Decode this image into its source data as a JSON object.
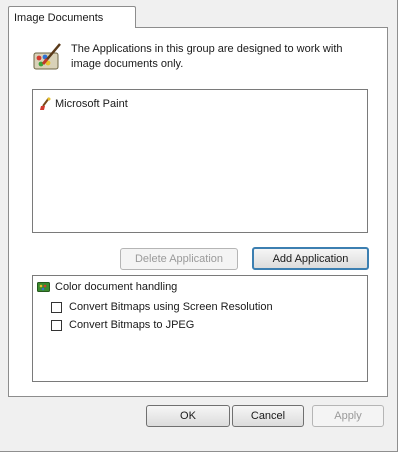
{
  "tab": {
    "label": "Image Documents"
  },
  "description": "The Applications in this group are designed to work with image documents only.",
  "applications": [
    {
      "label": "Microsoft Paint"
    }
  ],
  "buttons": {
    "delete": "Delete Application",
    "add": "Add Application",
    "ok": "OK",
    "cancel": "Cancel",
    "apply": "Apply"
  },
  "options": {
    "header": "Color document handling",
    "checkboxes": [
      {
        "label": "Convert Bitmaps using Screen Resolution",
        "checked": false
      },
      {
        "label": "Convert Bitmaps to JPEG",
        "checked": false
      }
    ]
  },
  "icons": {
    "app_group": "paint-palette-brush-icon",
    "list_item": "paint-brush-icon",
    "color_handling": "color-palette-icon"
  }
}
